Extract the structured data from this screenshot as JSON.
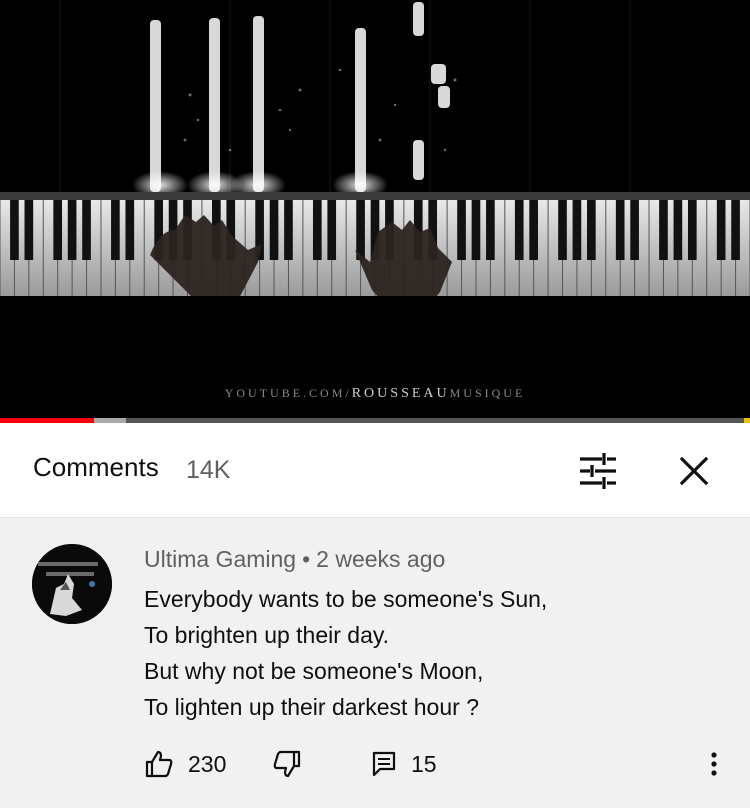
{
  "video": {
    "watermark_prefix": "YOUTUBE.COM/",
    "watermark_accent": "ROUSSEAU",
    "watermark_suffix": "MUSIQUE",
    "progress_played_fraction": 0.125,
    "progress_buffered_fraction": 0.168
  },
  "comments_header": {
    "title": "Comments",
    "count": "14K",
    "filter_icon": "sort-filter-icon",
    "close_icon": "close-icon"
  },
  "comment": {
    "author": "Ultima Gaming",
    "separator": "•",
    "time": "2 weeks ago",
    "lines": [
      "Everybody wants to be someone's Sun,",
      "To brighten up their day.",
      "But why not be someone's Moon,",
      "To lighten up their darkest hour ?"
    ],
    "likes": "230",
    "replies": "15",
    "like_icon": "thumbs-up-icon",
    "dislike_icon": "thumbs-down-icon",
    "reply_icon": "reply-comment-icon",
    "more_icon": "more-vertical-icon"
  },
  "colors": {
    "progress_played": "#ff0000",
    "header_bg": "#ffffff",
    "comment_bg": "#f1f1f1",
    "secondary_text": "#606060"
  }
}
